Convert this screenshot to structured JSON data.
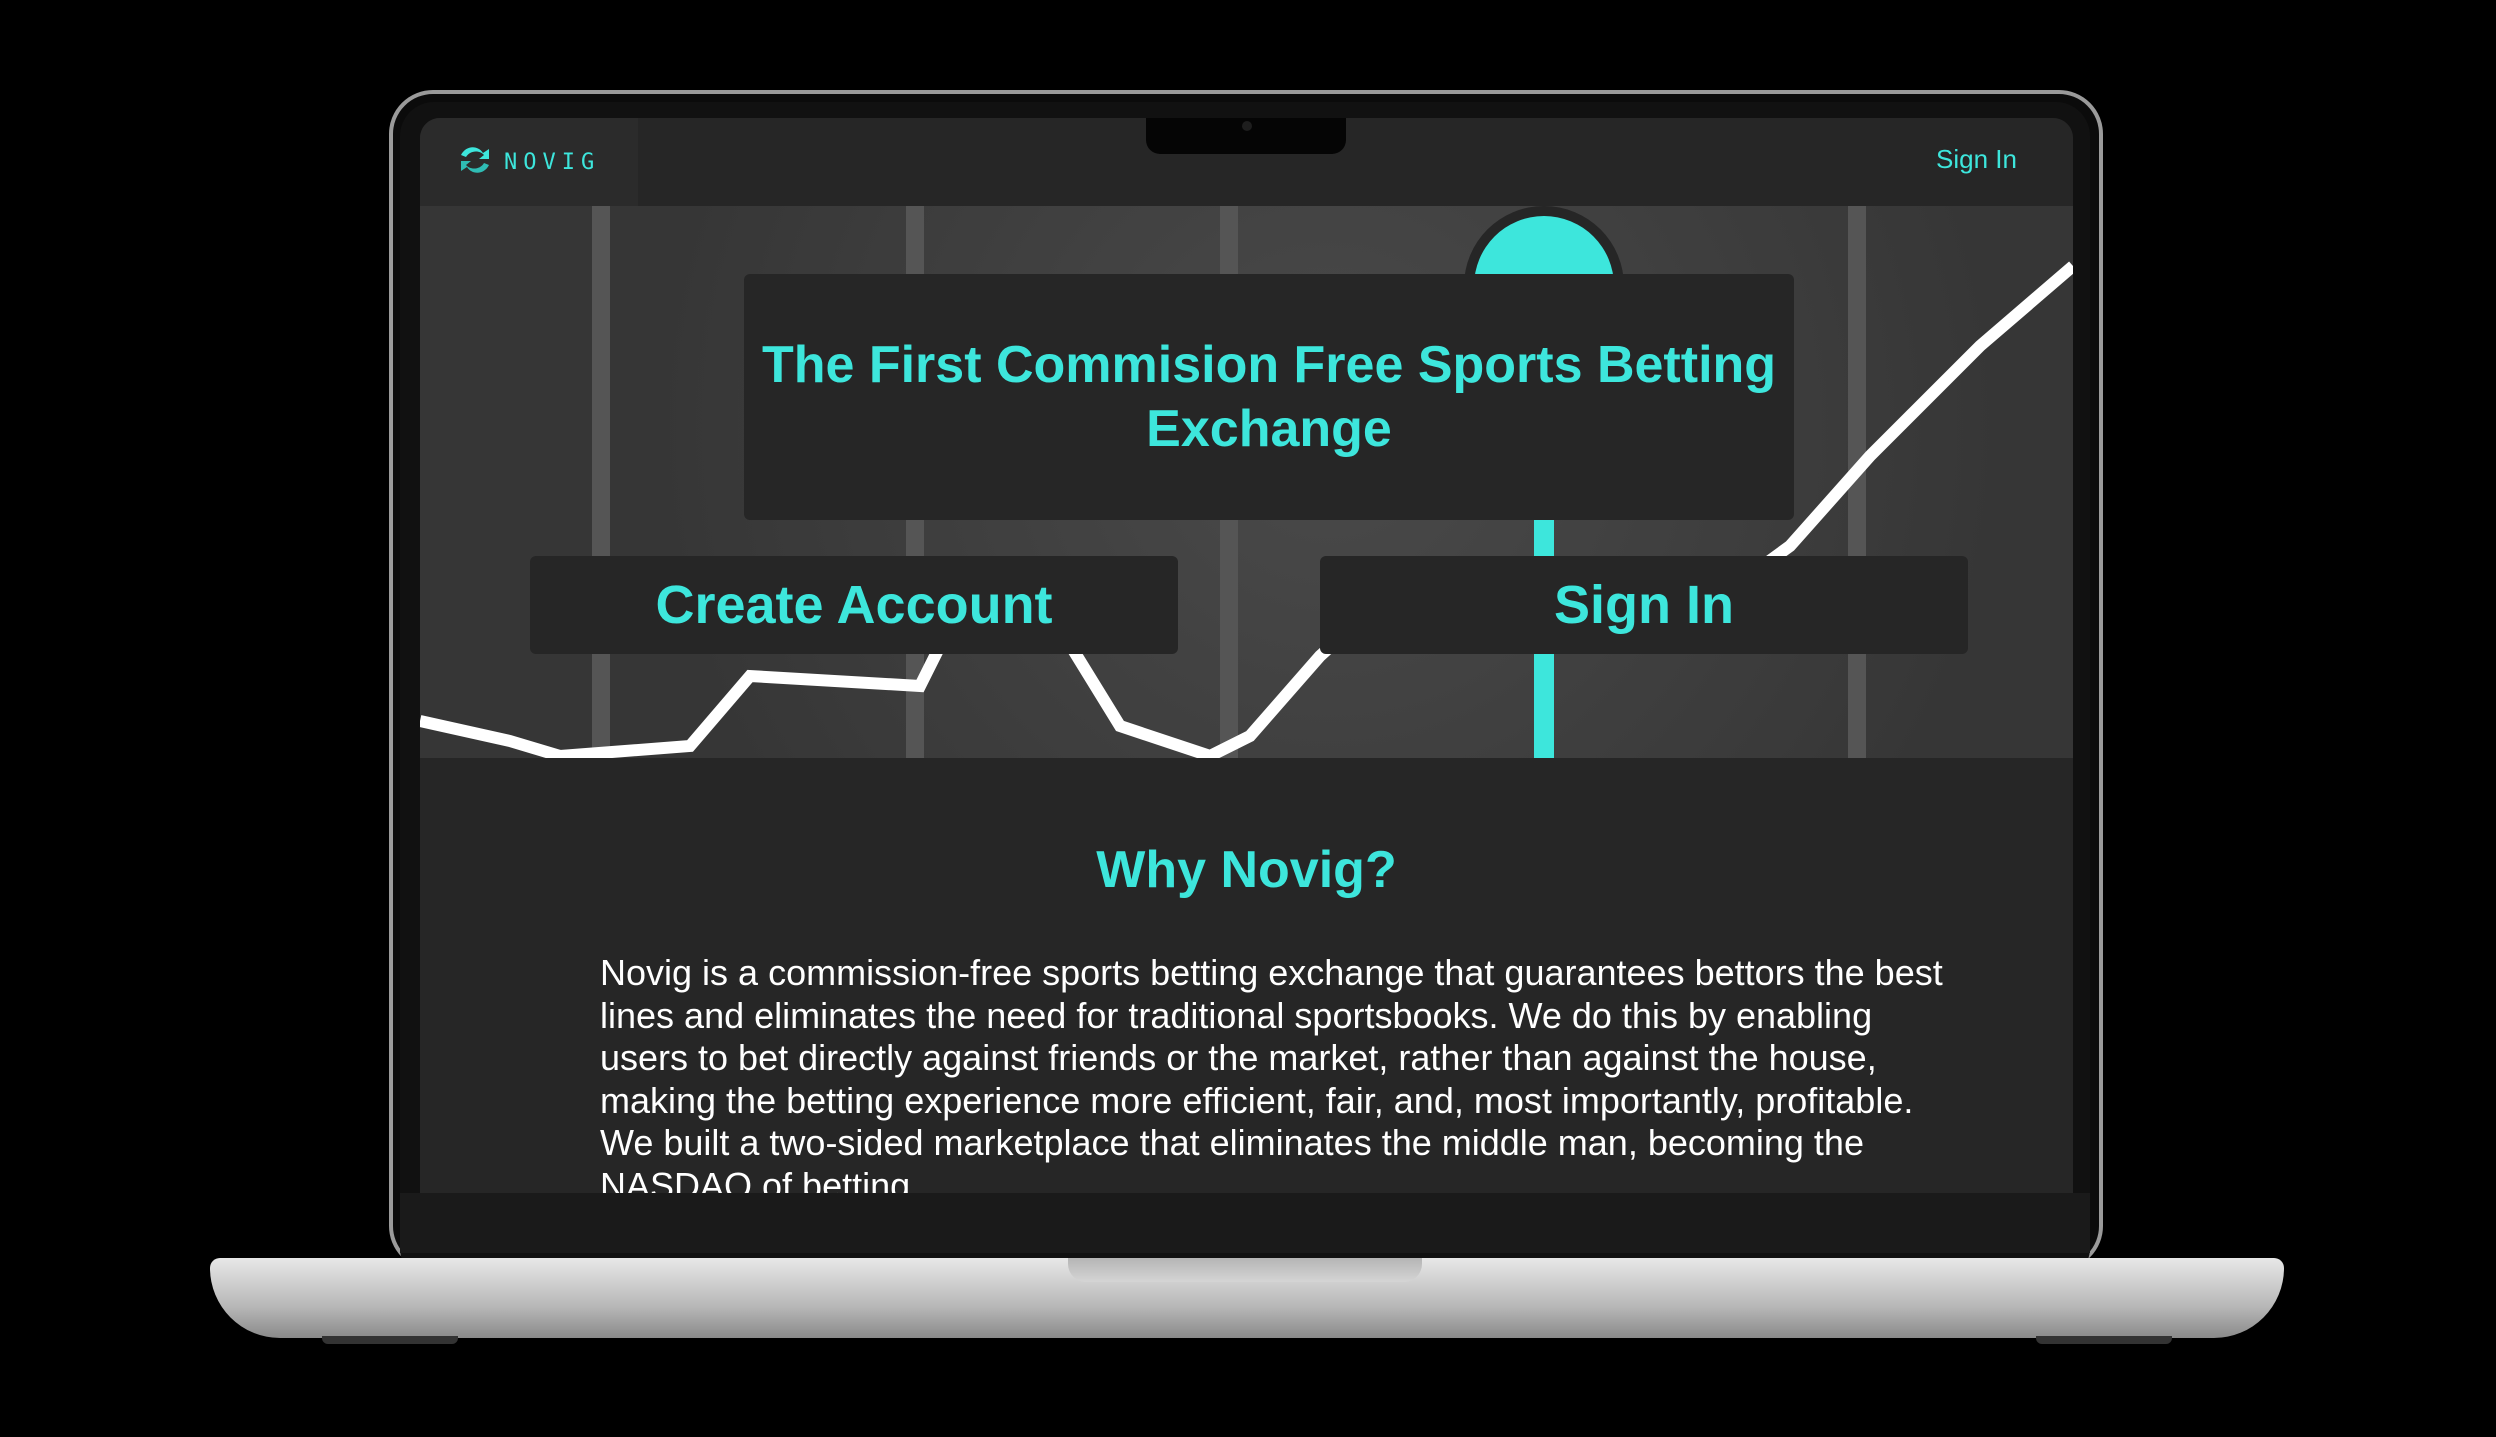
{
  "nav": {
    "brand": "NOVIG",
    "sign_in": "Sign In"
  },
  "hero": {
    "title": "The First Commision Free Sports Betting Exchange",
    "create_account": "Create Account",
    "sign_in": "Sign In"
  },
  "why": {
    "title": "Why Novig?",
    "body": "Novig is a commission-free sports betting exchange that guarantees bettors the best lines and eliminates the need for traditional sportsbooks. We do this by enabling users to bet directly against friends or the market, rather than against the house, making the betting experience more efficient, fair, and, most importantly, profitable. We built a two-sided marketplace that eliminates the middle man, becoming the NASDAQ of betting."
  },
  "colors": {
    "accent": "#3de6dc",
    "surface": "#262626",
    "text": "#ffffff"
  },
  "icons": {
    "brand_logo": "novig-logo-icon"
  }
}
